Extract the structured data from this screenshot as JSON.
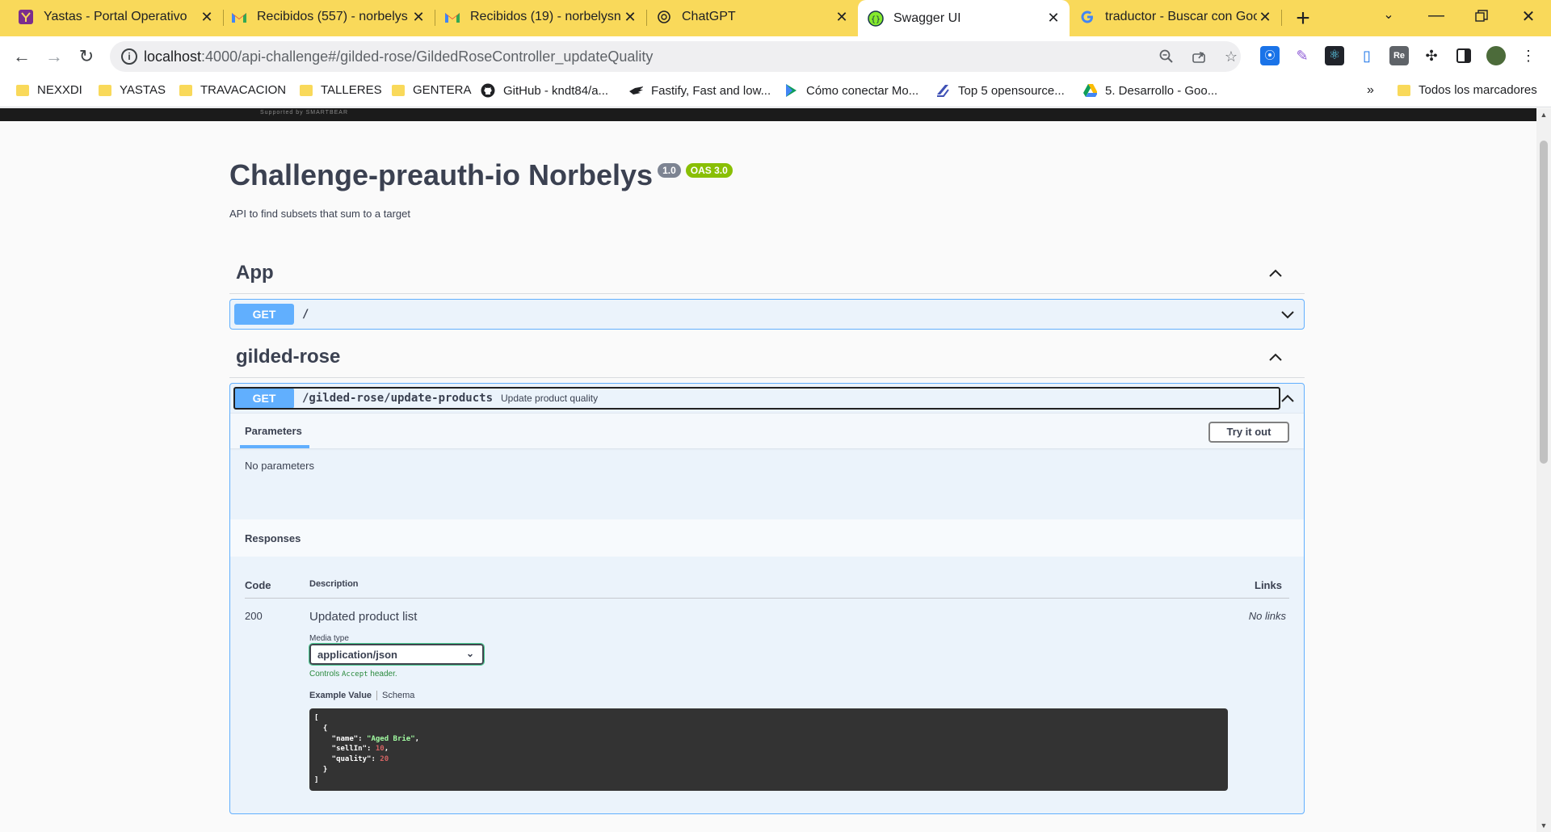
{
  "browser": {
    "tabs": [
      {
        "title": "Yastas - Portal Operativo",
        "icon": "yastas-icon"
      },
      {
        "title": "Recibidos (557) - norbelys",
        "icon": "gmail-icon"
      },
      {
        "title": "Recibidos (19) - norbelysn",
        "icon": "gmail-icon"
      },
      {
        "title": "ChatGPT",
        "icon": "chatgpt-icon"
      },
      {
        "title": "Swagger UI",
        "icon": "swagger-icon"
      },
      {
        "title": "traductor - Buscar con Goo",
        "icon": "google-icon"
      }
    ],
    "active_tab": 4,
    "url_host": "localhost",
    "url_rest": ":4000/api-challenge#/gilded-rose/GildedRoseController_updateQuality",
    "bookmarks": [
      {
        "label": "NEXXDI",
        "type": "folder"
      },
      {
        "label": "YASTAS",
        "type": "folder"
      },
      {
        "label": "TRAVACACION",
        "type": "folder"
      },
      {
        "label": "TALLERES",
        "type": "folder"
      },
      {
        "label": "GENTERA",
        "type": "folder"
      },
      {
        "label": "GitHub - kndt84/a...",
        "type": "github-icon"
      },
      {
        "label": "Fastify, Fast and low...",
        "type": "fastify-icon"
      },
      {
        "label": "Cómo conectar Mo...",
        "type": "play-icon"
      },
      {
        "label": "Top 5 opensource...",
        "type": "link-icon"
      },
      {
        "label": "5. Desarrollo - Goo...",
        "type": "drive-icon"
      }
    ],
    "bookmarks_overflow": "»",
    "all_bookmarks": "Todos los marcadores"
  },
  "swagger": {
    "topbar_note": "Supported by SMARTBEAR",
    "title": "Challenge-preauth-io Norbelys",
    "version": "1.0",
    "oas": "OAS 3.0",
    "description": "API to find subsets that sum to a target",
    "tags": [
      {
        "name": "App",
        "operations": [
          {
            "method": "GET",
            "path": "/",
            "summary": ""
          }
        ]
      },
      {
        "name": "gilded-rose",
        "operations": [
          {
            "method": "GET",
            "path": "/gilded-rose/update-products",
            "summary": "Update product quality",
            "parameters_label": "Parameters",
            "try_it_out": "Try it out",
            "no_parameters": "No parameters",
            "responses_label": "Responses",
            "columns": {
              "code": "Code",
              "description": "Description",
              "links": "Links"
            },
            "responses": [
              {
                "code": "200",
                "description": "Updated product list",
                "links": "No links",
                "media_type_label": "Media type",
                "media_type": "application/json",
                "controls_note_pre": "Controls ",
                "controls_note_code": "Accept",
                "controls_note_post": " header.",
                "example_tab": "Example Value",
                "schema_tab": "Schema",
                "example": [
                  {
                    "name": "Aged Brie",
                    "sellIn": 10,
                    "quality": 20
                  }
                ]
              }
            ]
          }
        ]
      }
    ]
  },
  "colors": {
    "get_method": "#61affe",
    "tab_strip": "#f9d95a",
    "oas_badge": "#89bf04",
    "version_badge": "#7d8492"
  }
}
